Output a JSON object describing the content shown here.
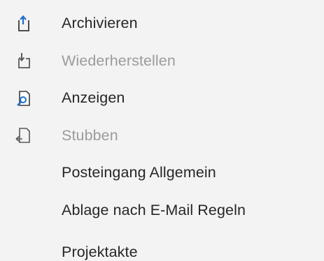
{
  "menu": {
    "items": [
      {
        "label": "Archivieren",
        "icon": "archive-icon",
        "enabled": true
      },
      {
        "label": "Wiederherstellen",
        "icon": "restore-icon",
        "enabled": false
      },
      {
        "label": "Anzeigen",
        "icon": "view-icon",
        "enabled": true
      },
      {
        "label": "Stubben",
        "icon": "stub-icon",
        "enabled": false
      },
      {
        "label": "Posteingang Allgemein",
        "icon": null,
        "enabled": true
      },
      {
        "label": "Ablage nach E-Mail Regeln",
        "icon": null,
        "enabled": true
      },
      {
        "label": "Projektakte",
        "icon": null,
        "enabled": true
      }
    ]
  },
  "colors": {
    "background": "#f3f3f3",
    "text": "#262626",
    "disabled_text": "#9c9c9c",
    "accent_blue": "#1e6fc7",
    "icon_gray": "#3a3a3a"
  }
}
